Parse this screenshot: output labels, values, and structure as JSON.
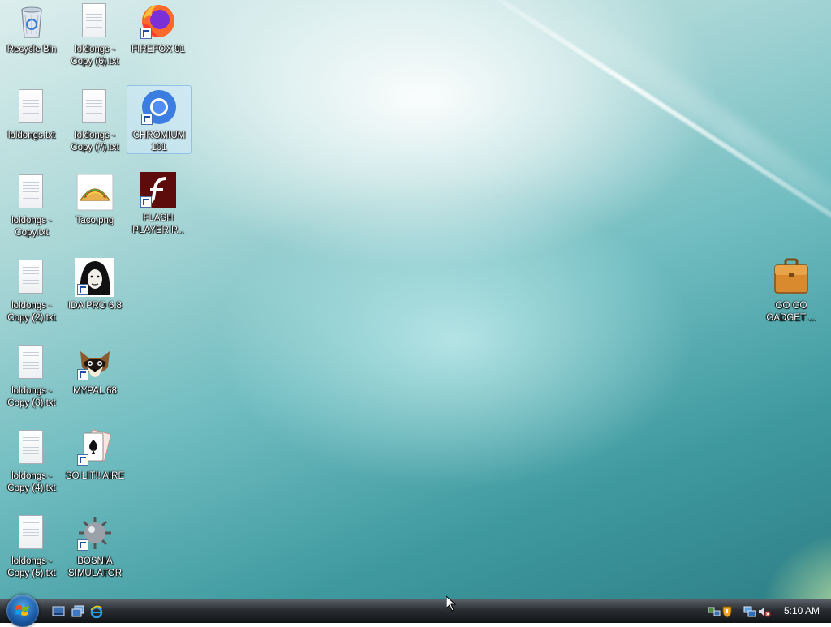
{
  "desktop": {
    "icons": [
      {
        "label": "Recycle Bin",
        "icon": "recycle-bin-icon"
      },
      {
        "label": "loldongs - Copy (6).txt",
        "icon": "text-file-icon"
      },
      {
        "label": "FIREFOX 91",
        "icon": "firefox-icon"
      },
      {
        "label": "loldongs.txt",
        "icon": "text-file-icon"
      },
      {
        "label": "loldongs - Copy (7).txt",
        "icon": "text-file-icon"
      },
      {
        "label": "CHROMIUM 101",
        "icon": "chromium-icon"
      },
      {
        "label": "loldongs - Copy.txt",
        "icon": "text-file-icon"
      },
      {
        "label": "Taco.png",
        "icon": "taco-image-icon"
      },
      {
        "label": "FLASH PLAYER P...",
        "icon": "flash-player-icon"
      },
      {
        "label": "loldongs - Copy (2).txt",
        "icon": "text-file-icon"
      },
      {
        "label": "IDA PRO 6.8",
        "icon": "ida-pro-icon"
      },
      {
        "label": "loldongs - Copy (3).txt",
        "icon": "text-file-icon"
      },
      {
        "label": "MYPAL 68",
        "icon": "mypal-icon"
      },
      {
        "label": "loldongs - Copy (4).txt",
        "icon": "text-file-icon"
      },
      {
        "label": "SO LIT!! AIRE",
        "icon": "solitaire-icon"
      },
      {
        "label": "loldongs - Copy (5).txt",
        "icon": "text-file-icon"
      },
      {
        "label": "BOSNIA SIMULATOR",
        "icon": "minesweeper-icon"
      },
      {
        "label": "GO GO GADGET ...",
        "icon": "briefcase-icon"
      }
    ],
    "selected": "CHROMIUM 101"
  },
  "taskbar": {
    "start_icon": "windows-start-orb",
    "quick_launch": [
      "show-desktop-icon",
      "switch-windows-icon",
      "internet-explorer-icon"
    ],
    "tray_icons": [
      "network-icon",
      "security-shield-icon",
      "network-connection-icon",
      "volume-muted-icon"
    ],
    "clock": "5:10 AM"
  },
  "colors": {
    "taskbar": "#1e2226",
    "desktop_accent": "#4aa6aa",
    "selection": "#cfe6ff"
  }
}
